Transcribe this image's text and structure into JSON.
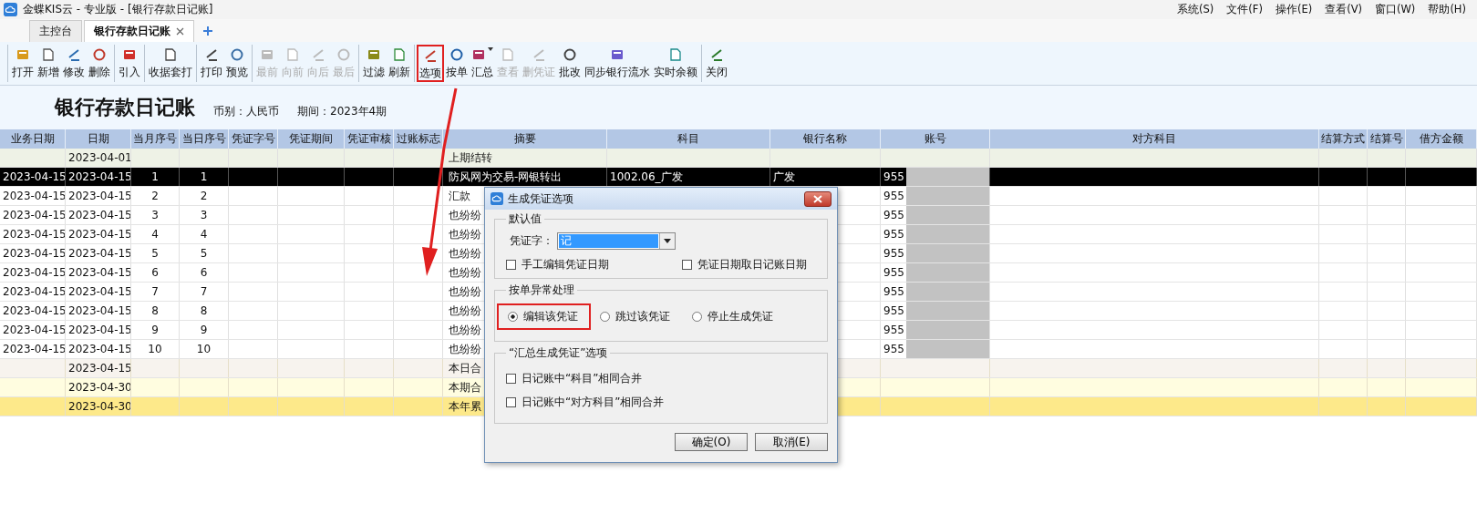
{
  "window": {
    "title": "金蝶KIS云 - 专业版 - [银行存款日记账]"
  },
  "menu": [
    "系统(S)",
    "文件(F)",
    "操作(E)",
    "查看(V)",
    "窗口(W)",
    "帮助(H)"
  ],
  "tabs": [
    {
      "label": "主控台",
      "selected": false,
      "closable": false
    },
    {
      "label": "银行存款日记账",
      "selected": true,
      "closable": true
    }
  ],
  "toolbar": {
    "groups": [
      [
        {
          "label": "打开",
          "disabled": false,
          "highlighted": false
        },
        {
          "label": "新增",
          "disabled": false,
          "highlighted": false
        },
        {
          "label": "修改",
          "disabled": false,
          "highlighted": false
        },
        {
          "label": "删除",
          "disabled": false,
          "highlighted": false
        }
      ],
      [
        {
          "label": "引入",
          "disabled": false,
          "highlighted": false
        }
      ],
      [
        {
          "label": "收据套打",
          "disabled": false,
          "highlighted": false
        }
      ],
      [
        {
          "label": "打印",
          "disabled": false,
          "highlighted": false
        },
        {
          "label": "预览",
          "disabled": false,
          "highlighted": false
        }
      ],
      [
        {
          "label": "最前",
          "disabled": true,
          "highlighted": false
        },
        {
          "label": "向前",
          "disabled": true,
          "highlighted": false
        },
        {
          "label": "向后",
          "disabled": true,
          "highlighted": false
        },
        {
          "label": "最后",
          "disabled": true,
          "highlighted": false
        }
      ],
      [
        {
          "label": "过滤",
          "disabled": false,
          "highlighted": false
        },
        {
          "label": "刷新",
          "disabled": false,
          "highlighted": false
        }
      ],
      [
        {
          "label": "选项",
          "disabled": false,
          "highlighted": true
        },
        {
          "label": "按单",
          "disabled": false,
          "highlighted": false
        },
        {
          "label": "汇总",
          "disabled": false,
          "highlighted": false,
          "dropdown": true
        },
        {
          "label": "查看",
          "disabled": true,
          "highlighted": false
        },
        {
          "label": "删凭证",
          "disabled": true,
          "highlighted": false
        },
        {
          "label": "批改",
          "disabled": false,
          "highlighted": false
        },
        {
          "label": "同步银行流水",
          "disabled": false,
          "highlighted": false
        },
        {
          "label": "实时余额",
          "disabled": false,
          "highlighted": false
        }
      ],
      [
        {
          "label": "关闭",
          "disabled": false,
          "highlighted": false
        }
      ]
    ]
  },
  "report": {
    "title": "银行存款日记账",
    "currency": "币别：人民币",
    "period": "期间：2023年4期"
  },
  "table": {
    "columns": [
      "业务日期",
      "日期",
      "当月序号",
      "当日序号",
      "凭证字号",
      "凭证期间",
      "凭证审核",
      "过账标志",
      "摘要",
      "科目",
      "银行名称",
      "账号",
      "对方科目",
      "结算方式",
      "结算号",
      "借方金额"
    ],
    "rows": [
      {
        "kind": "carry",
        "selected": false,
        "redacted": false,
        "date": "2023-04-01",
        "summary": "上期结转"
      },
      {
        "kind": "entry",
        "selected": true,
        "redacted": true,
        "biz_date": "2023-04-15",
        "date": "2023-04-15",
        "month_seq": "1",
        "day_seq": "1",
        "summary": "防风网为交易-网银转出",
        "account": "1002.06_广发",
        "bank": "广发",
        "account_no": "955"
      },
      {
        "kind": "entry",
        "selected": false,
        "redacted": true,
        "biz_date": "2023-04-15",
        "date": "2023-04-15",
        "month_seq": "2",
        "day_seq": "2",
        "summary": "汇款",
        "account_no": "955"
      },
      {
        "kind": "entry",
        "selected": false,
        "redacted": true,
        "biz_date": "2023-04-15",
        "date": "2023-04-15",
        "month_seq": "3",
        "day_seq": "3",
        "summary": "也纷纷",
        "account_no": "955"
      },
      {
        "kind": "entry",
        "selected": false,
        "redacted": true,
        "biz_date": "2023-04-15",
        "date": "2023-04-15",
        "month_seq": "4",
        "day_seq": "4",
        "summary": "也纷纷",
        "account_no": "955"
      },
      {
        "kind": "entry",
        "selected": false,
        "redacted": true,
        "biz_date": "2023-04-15",
        "date": "2023-04-15",
        "month_seq": "5",
        "day_seq": "5",
        "summary": "也纷纷",
        "account_no": "955"
      },
      {
        "kind": "entry",
        "selected": false,
        "redacted": true,
        "biz_date": "2023-04-15",
        "date": "2023-04-15",
        "month_seq": "6",
        "day_seq": "6",
        "summary": "也纷纷",
        "account_no": "955"
      },
      {
        "kind": "entry",
        "selected": false,
        "redacted": true,
        "biz_date": "2023-04-15",
        "date": "2023-04-15",
        "month_seq": "7",
        "day_seq": "7",
        "summary": "也纷纷",
        "account_no": "955"
      },
      {
        "kind": "entry",
        "selected": false,
        "redacted": true,
        "biz_date": "2023-04-15",
        "date": "2023-04-15",
        "month_seq": "8",
        "day_seq": "8",
        "summary": "也纷纷",
        "account_no": "955"
      },
      {
        "kind": "entry",
        "selected": false,
        "redacted": true,
        "biz_date": "2023-04-15",
        "date": "2023-04-15",
        "month_seq": "9",
        "day_seq": "9",
        "summary": "也纷纷",
        "account_no": "955"
      },
      {
        "kind": "entry",
        "selected": false,
        "redacted": true,
        "biz_date": "2023-04-15",
        "date": "2023-04-15",
        "month_seq": "10",
        "day_seq": "10",
        "summary": "也纷纷",
        "account_no": "955"
      },
      {
        "kind": "day-total",
        "selected": false,
        "redacted": false,
        "date": "2023-04-15",
        "summary": "本日合"
      },
      {
        "kind": "period-total",
        "selected": false,
        "redacted": false,
        "date": "2023-04-30",
        "summary": "本期合"
      },
      {
        "kind": "year-total",
        "selected": false,
        "redacted": false,
        "date": "2023-04-30",
        "summary": "本年累"
      }
    ]
  },
  "dialog": {
    "title": "生成凭证选项",
    "defaults": {
      "legend": "默认值",
      "voucher_label": "凭证字：",
      "voucher_value": "记",
      "checkboxes": [
        {
          "label": "手工编辑凭证日期",
          "checked": false
        },
        {
          "label": "凭证日期取日记账日期",
          "checked": false
        }
      ]
    },
    "exception": {
      "legend": "按单异常处理",
      "options": [
        {
          "label": "编辑该凭证",
          "selected": true,
          "highlighted": true
        },
        {
          "label": "跳过该凭证",
          "selected": false,
          "highlighted": false
        },
        {
          "label": "停止生成凭证",
          "selected": false,
          "highlighted": false
        }
      ]
    },
    "summary": {
      "legend": "“汇总生成凭证”选项",
      "checkboxes": [
        {
          "label": "日记账中“科目”相同合并",
          "checked": false
        },
        {
          "label": "日记账中“对方科目”相同合并",
          "checked": false
        }
      ]
    },
    "buttons": [
      "确定(O)",
      "取消(E)"
    ]
  }
}
